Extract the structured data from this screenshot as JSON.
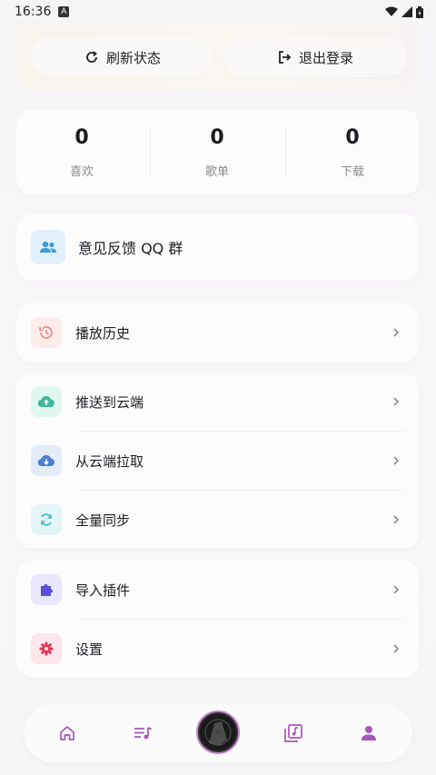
{
  "status_bar": {
    "time": "16:36",
    "badge": "A"
  },
  "header": {
    "refresh_label": "刷新状态",
    "logout_label": "退出登录"
  },
  "stats": [
    {
      "value": "0",
      "label": "喜欢"
    },
    {
      "value": "0",
      "label": "歌单"
    },
    {
      "value": "0",
      "label": "下载"
    }
  ],
  "feedback": {
    "label": "意见反馈 QQ 群"
  },
  "history": {
    "label": "播放历史"
  },
  "cloud": [
    {
      "label": "推送到云端",
      "icon": "cloud-upload-icon"
    },
    {
      "label": "从云端拉取",
      "icon": "cloud-download-icon"
    },
    {
      "label": "全量同步",
      "icon": "sync-icon"
    }
  ],
  "tools": [
    {
      "label": "导入插件",
      "icon": "puzzle-icon"
    },
    {
      "label": "设置",
      "icon": "gear-icon"
    }
  ],
  "nav": [
    {
      "name": "home",
      "icon": "home-icon"
    },
    {
      "name": "playlist",
      "icon": "playlist-icon"
    },
    {
      "name": "now-playing",
      "icon": "disc-icon"
    },
    {
      "name": "library",
      "icon": "music-library-icon"
    },
    {
      "name": "profile",
      "icon": "person-icon",
      "active": true
    }
  ],
  "colors": {
    "accent": "#a855b8",
    "feedback_icon_bg": "#e2f0fb",
    "history_icon_bg": "#fdecea",
    "upload_icon_bg": "#e2f6f1",
    "download_icon_bg": "#e4ecf8",
    "sync_icon_bg": "#e4f5f8",
    "plugin_icon_bg": "#e9e7fb",
    "settings_icon_bg": "#fde6ec"
  }
}
